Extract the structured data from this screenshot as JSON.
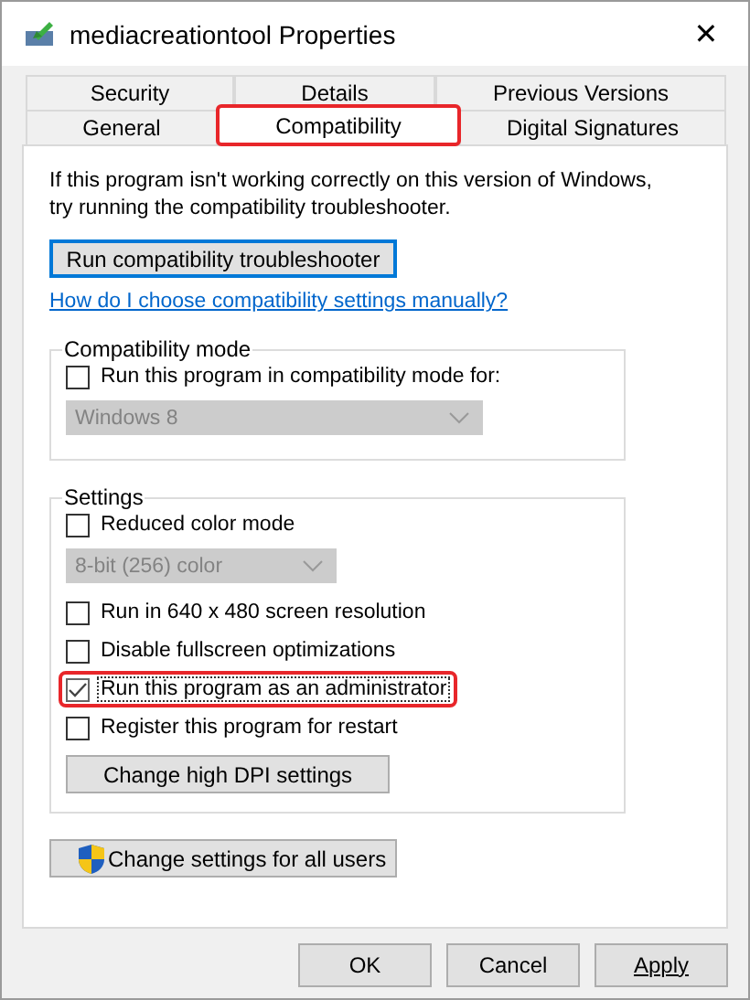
{
  "window": {
    "title": "mediacreationtool Properties",
    "close": "✕"
  },
  "tab_rows": [
    {
      "tabs": [
        {
          "label": "Security",
          "selected": false,
          "highlighted": false
        },
        {
          "label": "Details",
          "selected": false,
          "highlighted": false
        },
        {
          "label": "Previous Versions",
          "selected": false,
          "highlighted": false
        }
      ]
    },
    {
      "tabs": [
        {
          "label": "General",
          "selected": false,
          "highlighted": false
        },
        {
          "label": "Compatibility",
          "selected": true,
          "highlighted": true
        },
        {
          "label": "Digital Signatures",
          "selected": false,
          "highlighted": false
        }
      ]
    }
  ],
  "intro": "If this program isn't working correctly on this version of Windows, try running the compatibility troubleshooter.",
  "troubleshooter_button": "Run compatibility troubleshooter",
  "help_link": "How do I choose compatibility settings manually?",
  "groups": [
    {
      "label": "Compatibility mode",
      "items": [
        {
          "kind": "checkbox",
          "label": "Run this program in compatibility mode for:",
          "checked": false,
          "highlighted": false,
          "focused": false
        },
        {
          "kind": "dropdown",
          "value": "Windows 8",
          "disabled": true,
          "wide": true
        }
      ]
    },
    {
      "label": "Settings",
      "items": [
        {
          "kind": "checkbox",
          "label": "Reduced color mode",
          "checked": false,
          "highlighted": false,
          "focused": false
        },
        {
          "kind": "dropdown",
          "value": "8-bit (256) color",
          "disabled": true,
          "wide": false
        },
        {
          "kind": "checkbox",
          "label": "Run in 640 x 480 screen resolution",
          "checked": false,
          "highlighted": false,
          "focused": false
        },
        {
          "kind": "checkbox",
          "label": "Disable fullscreen optimizations",
          "checked": false,
          "highlighted": false,
          "focused": false
        },
        {
          "kind": "checkbox",
          "label": "Run this program as an administrator",
          "checked": true,
          "highlighted": true,
          "focused": true
        },
        {
          "kind": "checkbox",
          "label": "Register this program for restart",
          "checked": false,
          "highlighted": false,
          "focused": false
        },
        {
          "kind": "button",
          "label": "Change high DPI settings"
        }
      ]
    }
  ],
  "all_users_button": "Change settings for all users",
  "buttons": [
    {
      "label": "OK",
      "mnemonic": false
    },
    {
      "label": "Cancel",
      "mnemonic": false
    },
    {
      "label": "Apply",
      "mnemonic": true
    }
  ]
}
